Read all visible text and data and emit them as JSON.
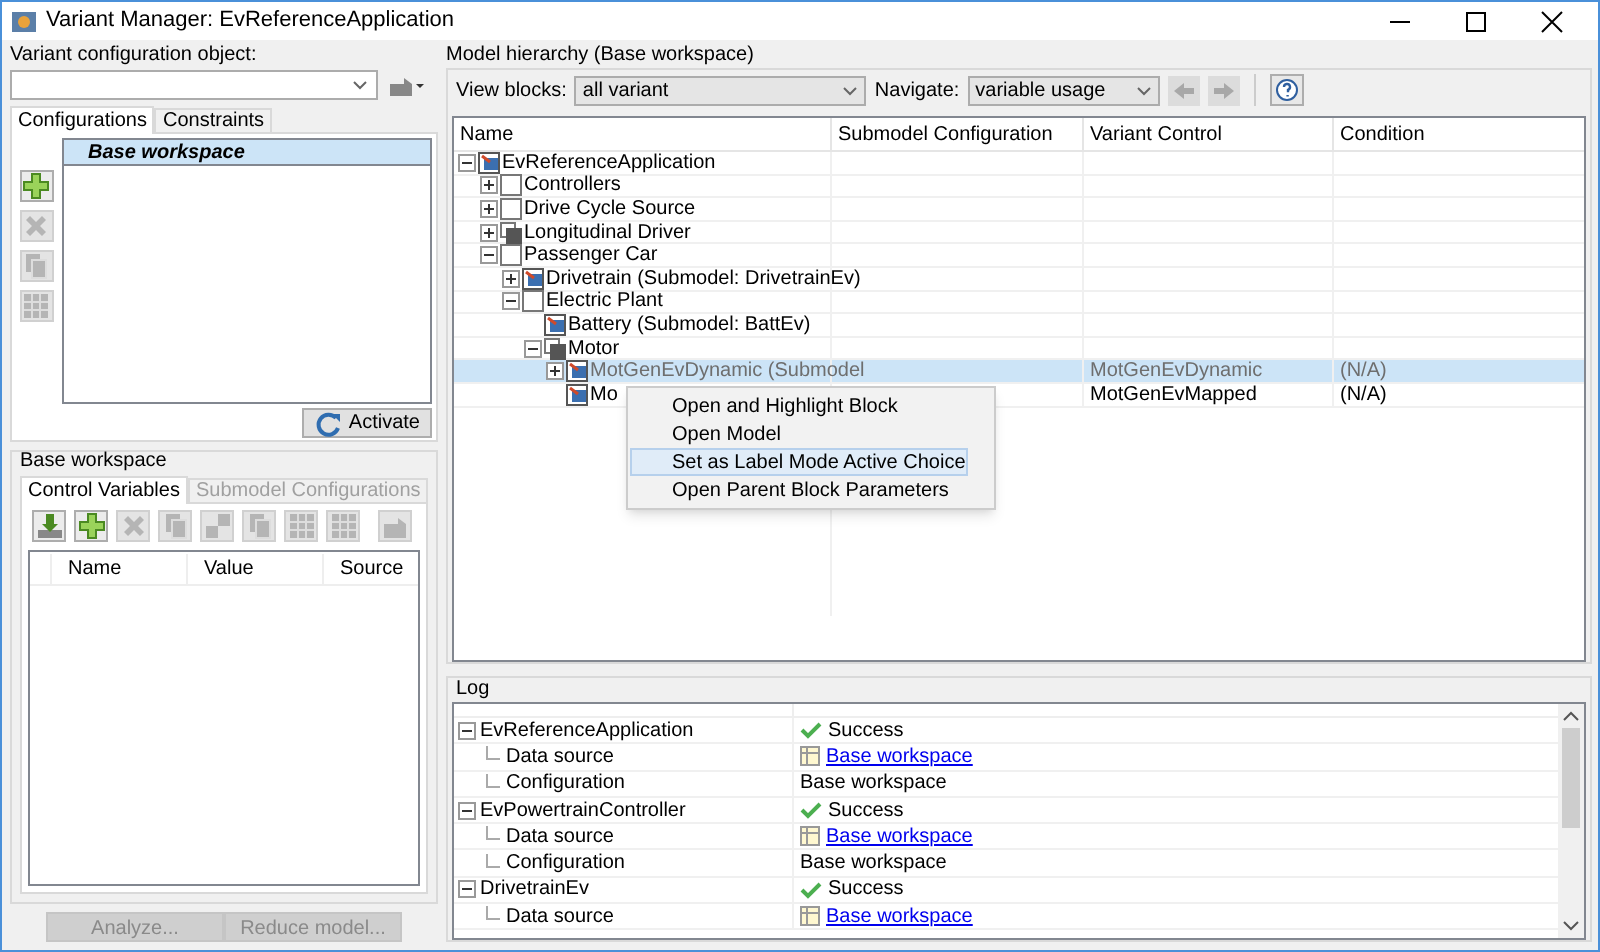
{
  "window": {
    "title": "Variant Manager: EvReferenceApplication"
  },
  "config_object": {
    "label": "Variant configuration object:"
  },
  "config_tabs": [
    {
      "label": "Configurations",
      "selected": true
    },
    {
      "label": "Constraints",
      "selected": false
    }
  ],
  "config_toolbar": [
    {
      "kind": "add",
      "disabled": false
    },
    {
      "kind": "delete",
      "disabled": true
    },
    {
      "kind": "copy",
      "disabled": true
    },
    {
      "kind": "grid",
      "disabled": true
    }
  ],
  "configurations": [
    {
      "name": "Base workspace",
      "selected": true
    }
  ],
  "activate_button": "Activate",
  "workspace_group": {
    "title": "Base workspace"
  },
  "workspace_tabs": [
    {
      "label": "Control Variables",
      "selected": true,
      "disabled": false
    },
    {
      "label": "Submodel Configurations",
      "selected": false,
      "disabled": true
    }
  ],
  "variables_toolbar": [
    {
      "kind": "import",
      "disabled": false
    },
    {
      "kind": "add",
      "disabled": false
    },
    {
      "kind": "delete",
      "disabled": true
    },
    {
      "kind": "copy",
      "disabled": true
    },
    {
      "kind": "blocks",
      "disabled": true
    },
    {
      "kind": "copy",
      "disabled": true
    },
    {
      "kind": "grid",
      "disabled": true
    },
    {
      "kind": "grid",
      "disabled": true
    },
    {
      "kind": "export",
      "disabled": true
    }
  ],
  "variables_table": {
    "columns": [
      "Name",
      "Value",
      "Source"
    ]
  },
  "footer_buttons": [
    {
      "label": "Analyze...",
      "disabled": true
    },
    {
      "label": "Reduce model...",
      "disabled": true
    }
  ],
  "hierarchy": {
    "title": "Model hierarchy (Base workspace)",
    "view_blocks_label": "View blocks:",
    "view_blocks_value": "all variant",
    "navigate_label": "Navigate:",
    "navigate_value": "variable usage",
    "columns": [
      "Name",
      "Submodel Configuration",
      "Variant Control",
      "Condition"
    ],
    "rows": [
      {
        "name": "EvReferenceApplication",
        "kind": "model",
        "expanded": true,
        "selected": false,
        "disabled": false,
        "children": [
          {
            "name": "Controllers",
            "kind": "subsystem",
            "expanded": false,
            "selected": false,
            "disabled": false
          },
          {
            "name": "Drive Cycle Source",
            "kind": "subsystem",
            "expanded": false,
            "selected": false,
            "disabled": false
          },
          {
            "name": "Longitudinal Driver",
            "kind": "variant",
            "expanded": false,
            "selected": false,
            "disabled": false
          },
          {
            "name": "Passenger Car",
            "kind": "subsystem",
            "expanded": true,
            "selected": false,
            "disabled": false,
            "children": [
              {
                "name": "Drivetrain (Submodel: DrivetrainEv)",
                "kind": "model",
                "expanded": false,
                "selected": false,
                "disabled": false
              },
              {
                "name": "Electric Plant",
                "kind": "subsystem",
                "expanded": true,
                "selected": false,
                "disabled": false,
                "children": [
                  {
                    "name": "Battery (Submodel: BattEv)",
                    "kind": "model",
                    "selected": false,
                    "disabled": false
                  },
                  {
                    "name": "Motor",
                    "kind": "variant",
                    "expanded": true,
                    "selected": false,
                    "disabled": false,
                    "children": [
                      {
                        "name": "MotGenEvDynamic (Submodel",
                        "kind": "model",
                        "expanded": false,
                        "selected": true,
                        "disabled": true,
                        "variant_control": "MotGenEvDynamic",
                        "condition": "(N/A)"
                      },
                      {
                        "name": "Mo",
                        "kind": "model",
                        "selected": false,
                        "disabled": false,
                        "variant_control": "MotGenEvMapped",
                        "condition": "(N/A)"
                      }
                    ]
                  }
                ]
              }
            ]
          }
        ]
      }
    ]
  },
  "context_menu": [
    {
      "label": "Open and Highlight Block",
      "selected": false
    },
    {
      "label": "Open Model",
      "selected": false
    },
    {
      "label": "Set as Label Mode Active Choice",
      "selected": true
    },
    {
      "label": "Open Parent Block Parameters",
      "selected": false
    }
  ],
  "log": {
    "title": "Log",
    "rows": [
      {
        "name": "EvReferenceApplication",
        "status": "Success",
        "expanded": true,
        "children": [
          {
            "name": "Data source",
            "kind": "link",
            "value": "Base workspace"
          },
          {
            "name": "Configuration",
            "kind": "text",
            "value": "Base workspace"
          }
        ]
      },
      {
        "name": "EvPowertrainController",
        "status": "Success",
        "expanded": true,
        "children": [
          {
            "name": "Data source",
            "kind": "link",
            "value": "Base workspace"
          },
          {
            "name": "Configuration",
            "kind": "text",
            "value": "Base workspace"
          }
        ]
      },
      {
        "name": "DrivetrainEv",
        "status": "Success",
        "expanded": true,
        "children": [
          {
            "name": "Data source",
            "kind": "link",
            "value": "Base workspace"
          }
        ]
      }
    ]
  }
}
